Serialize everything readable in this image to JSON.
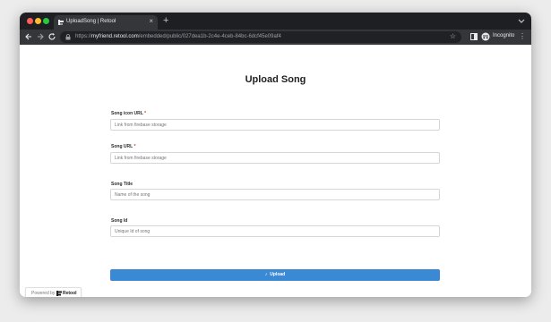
{
  "browser": {
    "tab_title": "UploadSong | Retool",
    "tab_close_icon": "close-icon",
    "new_tab_icon": "plus-icon",
    "url_scheme": "https://",
    "url_host": "myfriend.retool.com",
    "url_path": "/embedded/public/027dea1b-2c4e-4ceb-84bc-6dcf45e09af4",
    "incognito_label": "Incognito",
    "colors": {
      "frame": "#1e1f22",
      "toolbar": "#35363a",
      "omnibox": "#202124"
    }
  },
  "form": {
    "title": "Upload Song",
    "fields": [
      {
        "label": "Song icon URL",
        "required_mark": "*",
        "placeholder": "Link from firebase storage"
      },
      {
        "label": "Song URL",
        "required_mark": "*",
        "placeholder": "Link from firebase storage"
      },
      {
        "label": "Song Title",
        "required_mark": "",
        "placeholder": "Name of the song"
      },
      {
        "label": "Song Id",
        "required_mark": "",
        "placeholder": "Unique Id of song"
      }
    ],
    "submit_label": "Upload",
    "submit_icon": "music-note-icon",
    "accent_color": "#3a89d4"
  },
  "footer": {
    "powered_by": "Powered by",
    "brand": "Retool"
  }
}
